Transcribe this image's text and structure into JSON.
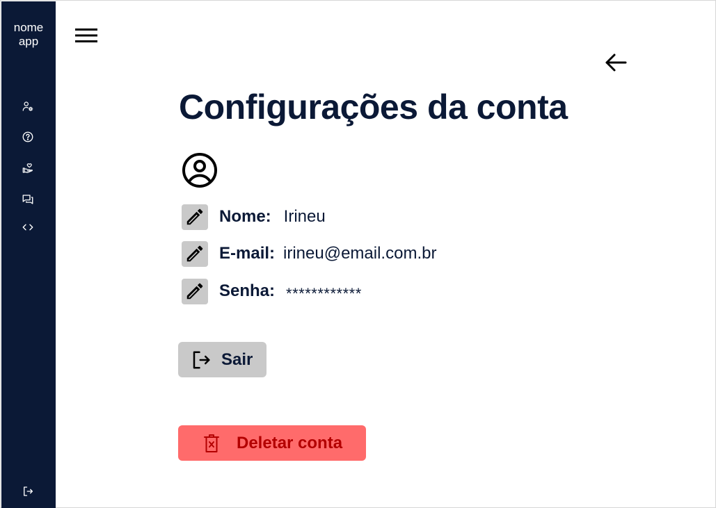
{
  "app": {
    "name_line1": "nome",
    "name_line2": "app"
  },
  "sidebar": {
    "items": [
      {
        "icon": "user-settings-icon"
      },
      {
        "icon": "help-icon"
      },
      {
        "icon": "donate-heart-icon"
      },
      {
        "icon": "chat-icon"
      },
      {
        "icon": "code-icon"
      }
    ],
    "footer_icon": "logout-icon"
  },
  "page": {
    "title": "Configurações da conta"
  },
  "fields": [
    {
      "label": "Nome:",
      "value": "Irineu"
    },
    {
      "label": "E-mail:",
      "value": "irineu@email.com.br"
    },
    {
      "label": "Senha:",
      "value": "************"
    }
  ],
  "actions": {
    "logout_label": "Sair",
    "delete_label": "Deletar conta"
  },
  "colors": {
    "sidebar_bg": "#0b1936",
    "text_dark": "#0b1936",
    "button_gray": "#c9c9c9",
    "danger_bg": "#ff6b6b",
    "danger_text": "#b30000"
  }
}
